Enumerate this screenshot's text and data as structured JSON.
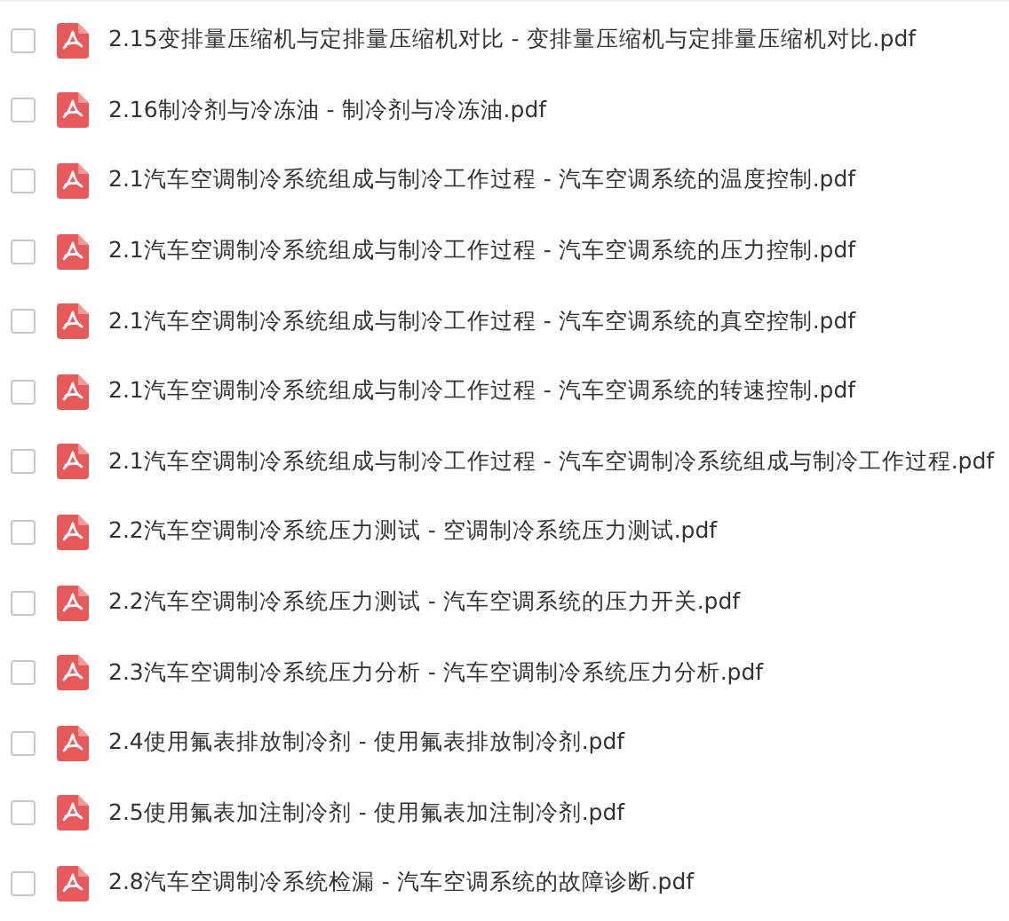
{
  "files": [
    {
      "name": "2.15变排量压缩机与定排量压缩机对比 - 变排量压缩机与定排量压缩机对比.pdf",
      "checked": false
    },
    {
      "name": "2.16制冷剂与冷冻油 - 制冷剂与冷冻油.pdf",
      "checked": false
    },
    {
      "name": "2.1汽车空调制冷系统组成与制冷工作过程 - 汽车空调系统的温度控制.pdf",
      "checked": false
    },
    {
      "name": "2.1汽车空调制冷系统组成与制冷工作过程 - 汽车空调系统的压力控制.pdf",
      "checked": false
    },
    {
      "name": "2.1汽车空调制冷系统组成与制冷工作过程 - 汽车空调系统的真空控制.pdf",
      "checked": false
    },
    {
      "name": "2.1汽车空调制冷系统组成与制冷工作过程 - 汽车空调系统的转速控制.pdf",
      "checked": false
    },
    {
      "name": "2.1汽车空调制冷系统组成与制冷工作过程 - 汽车空调制冷系统组成与制冷工作过程.pdf",
      "checked": false
    },
    {
      "name": "2.2汽车空调制冷系统压力测试 - 空调制冷系统压力测试.pdf",
      "checked": false
    },
    {
      "name": "2.2汽车空调制冷系统压力测试 - 汽车空调系统的压力开关.pdf",
      "checked": false
    },
    {
      "name": "2.3汽车空调制冷系统压力分析 - 汽车空调制冷系统压力分析.pdf",
      "checked": false
    },
    {
      "name": "2.4使用氟表排放制冷剂 - 使用氟表排放制冷剂.pdf",
      "checked": false
    },
    {
      "name": "2.5使用氟表加注制冷剂 - 使用氟表加注制冷剂.pdf",
      "checked": false
    },
    {
      "name": "2.8汽车空调制冷系统检漏 - 汽车空调系统的故障诊断.pdf",
      "checked": false
    }
  ]
}
